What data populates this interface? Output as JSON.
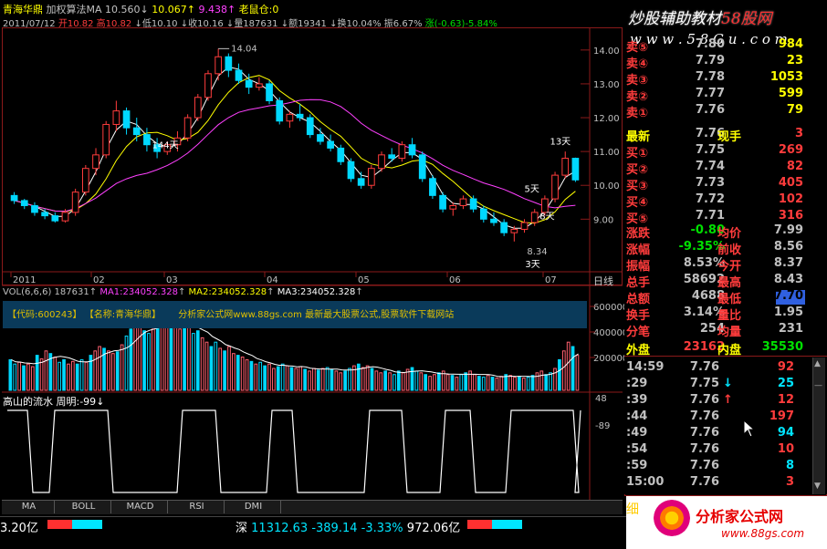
{
  "header": {
    "stock_name": "青海华鼎",
    "method": "加权算法MA",
    "ma_val1": "10.560",
    "ma_arrow1": "↓",
    "ma_val2": "10.067",
    "ma_arrow2": "↑",
    "ma_val3": "9.438",
    "ma_arrow3": "↑",
    "indicator": "老鼠仓:0",
    "date": "2011/07/12",
    "open": "开10.82",
    "high": "高10.82",
    "low_arrow": "↓",
    "low": "低10.10",
    "close_arrow": "↓",
    "close": "收10.16",
    "vol_arrow": "↓",
    "vol": "量187631",
    "amt_arrow": "↓",
    "amt": "额19341",
    "turn_arrow": "↓",
    "turn": "换10.04%",
    "amp": "振6.67%",
    "chg": "涨(-0.63)-5.84%"
  },
  "watermark": {
    "brand": "炒股辅助教材",
    "brand2": "58股网",
    "site": "w w w . 5 8 G u . c o m"
  },
  "chart_data": {
    "type": "candlestick",
    "ylim": [
      8.2,
      14.4
    ],
    "yticks": [
      "14.00",
      "13.00",
      "12.00",
      "11.00",
      "10.00",
      "9.00"
    ],
    "xticks": [
      "2011",
      "02",
      "03",
      "04",
      "05",
      "06",
      "07"
    ],
    "candles": [
      [
        9.7,
        9.8,
        9.45,
        9.55
      ],
      [
        9.55,
        9.6,
        9.3,
        9.4
      ],
      [
        9.4,
        9.5,
        9.1,
        9.2
      ],
      [
        9.2,
        9.3,
        9.0,
        9.1
      ],
      [
        9.1,
        9.2,
        8.9,
        8.95
      ],
      [
        8.95,
        9.3,
        8.9,
        9.2
      ],
      [
        9.2,
        9.9,
        9.1,
        9.8
      ],
      [
        9.8,
        10.6,
        9.7,
        10.5
      ],
      [
        10.5,
        11.1,
        10.3,
        10.9
      ],
      [
        10.9,
        11.9,
        10.8,
        11.8
      ],
      [
        11.8,
        12.5,
        11.6,
        12.2
      ],
      [
        12.2,
        12.3,
        11.5,
        11.7
      ],
      [
        11.7,
        12.0,
        11.3,
        11.5
      ],
      [
        11.5,
        11.7,
        11.0,
        11.2
      ],
      [
        11.2,
        11.4,
        10.8,
        11.0
      ],
      [
        11.0,
        11.3,
        10.9,
        11.2
      ],
      [
        11.2,
        11.6,
        11.0,
        11.4
      ],
      [
        11.4,
        12.1,
        11.3,
        12.0
      ],
      [
        12.0,
        12.7,
        11.9,
        12.6
      ],
      [
        12.6,
        13.4,
        12.5,
        13.3
      ],
      [
        13.3,
        14.04,
        13.1,
        13.8
      ],
      [
        13.8,
        13.9,
        13.2,
        13.4
      ],
      [
        13.4,
        13.6,
        13.0,
        13.1
      ],
      [
        13.1,
        13.3,
        12.7,
        12.9
      ],
      [
        12.9,
        13.2,
        12.8,
        13.0
      ],
      [
        13.0,
        13.1,
        12.4,
        12.5
      ],
      [
        12.5,
        12.6,
        11.8,
        11.9
      ],
      [
        11.9,
        12.2,
        11.7,
        12.1
      ],
      [
        12.1,
        12.4,
        11.9,
        12.0
      ],
      [
        12.0,
        12.1,
        11.4,
        11.5
      ],
      [
        11.5,
        11.7,
        11.2,
        11.3
      ],
      [
        11.3,
        11.5,
        11.0,
        11.1
      ],
      [
        11.1,
        11.2,
        10.6,
        10.7
      ],
      [
        10.7,
        10.8,
        10.1,
        10.2
      ],
      [
        10.2,
        10.4,
        9.9,
        10.0
      ],
      [
        10.0,
        10.6,
        9.9,
        10.5
      ],
      [
        10.5,
        11.0,
        10.4,
        10.9
      ],
      [
        10.9,
        11.1,
        10.7,
        10.8
      ],
      [
        10.8,
        11.3,
        10.7,
        11.2
      ],
      [
        11.2,
        11.4,
        10.8,
        10.9
      ],
      [
        10.9,
        11.0,
        10.1,
        10.2
      ],
      [
        10.2,
        10.3,
        9.6,
        9.7
      ],
      [
        9.7,
        9.8,
        9.2,
        9.3
      ],
      [
        9.3,
        9.5,
        9.1,
        9.4
      ],
      [
        9.4,
        9.7,
        9.3,
        9.6
      ],
      [
        9.6,
        9.7,
        9.2,
        9.3
      ],
      [
        9.3,
        9.4,
        8.9,
        9.0
      ],
      [
        9.0,
        9.2,
        8.8,
        8.9
      ],
      [
        8.9,
        9.0,
        8.5,
        8.6
      ],
      [
        8.6,
        8.8,
        8.34,
        8.7
      ],
      [
        8.7,
        9.0,
        8.6,
        8.9
      ],
      [
        8.9,
        9.3,
        8.8,
        9.2
      ],
      [
        9.2,
        9.7,
        9.1,
        9.6
      ],
      [
        9.6,
        10.4,
        9.5,
        10.3
      ],
      [
        10.3,
        11.0,
        10.2,
        10.8
      ],
      [
        10.8,
        10.82,
        10.1,
        10.16
      ]
    ],
    "labels": {
      "hi": "14.04",
      "lo": "8.34",
      "d13": "13天",
      "d144": "144天",
      "d5": "5天",
      "d8": "8天",
      "d3": "3天"
    }
  },
  "volume": {
    "title": "VOL(6,6,6)",
    "vol": "187631",
    "arrow": "↑",
    "ma1": "MA1:234052.328",
    "ma1_arrow": "↑",
    "ma2": "MA2:234052.328",
    "ma2_arrow": "↑",
    "ma3": "MA3:234052.328",
    "ma3_arrow": "↑",
    "yticks": [
      "600000",
      "400000",
      "200000"
    ],
    "code": "【代码:600243】",
    "name": "【名称:青海华鼎】",
    "banner": "分析家公式网www.88gs.com 最新最大股票公式,股票软件下载网站",
    "bars": [
      0.35,
      0.3,
      0.32,
      0.28,
      0.3,
      0.27,
      0.4,
      0.36,
      0.45,
      0.42,
      0.38,
      0.32,
      0.35,
      0.3,
      0.33,
      0.3,
      0.35,
      0.32,
      0.4,
      0.45,
      0.5,
      0.48,
      0.45,
      0.42,
      0.44,
      0.52,
      0.62,
      0.7,
      0.75,
      0.72,
      0.68,
      0.65,
      0.7,
      0.78,
      0.85,
      0.9,
      0.82,
      0.75,
      0.7,
      0.78,
      0.72,
      0.65,
      0.68,
      0.6,
      0.55,
      0.5,
      0.55,
      0.48,
      0.45,
      0.5,
      0.42,
      0.4,
      0.38,
      0.35,
      0.33,
      0.3,
      0.32,
      0.28,
      0.3,
      0.25,
      0.27,
      0.3,
      0.28,
      0.26,
      0.25,
      0.27,
      0.24,
      0.22,
      0.25,
      0.23,
      0.25,
      0.26,
      0.24,
      0.22,
      0.2,
      0.22,
      0.25,
      0.28,
      0.3,
      0.26,
      0.28,
      0.25,
      0.22,
      0.2,
      0.22,
      0.2,
      0.18,
      0.22,
      0.2,
      0.24,
      0.26,
      0.22,
      0.2,
      0.18,
      0.16,
      0.18,
      0.2,
      0.22,
      0.18,
      0.17,
      0.15,
      0.18,
      0.2,
      0.22,
      0.18,
      0.16,
      0.15,
      0.17,
      0.15,
      0.14,
      0.16,
      0.18,
      0.17,
      0.15,
      0.16,
      0.14,
      0.15,
      0.17,
      0.2,
      0.22,
      0.18,
      0.2,
      0.25,
      0.35,
      0.45,
      0.55,
      0.5,
      0.4
    ]
  },
  "lower": {
    "title": "高山的流水",
    "param": "周明:-99",
    "arrow": "↓",
    "yticks": [
      "48",
      "-89"
    ]
  },
  "tabs": [
    "MA",
    "BOLL",
    "MACD",
    "RSI",
    "DMI"
  ],
  "status": {
    "left_amt": "3.20亿",
    "index_name": "深",
    "index_val": "11312.63",
    "index_chg": "-389.14",
    "index_pct": "-3.33%",
    "index_amt": "972.06亿"
  },
  "quote": {
    "asks": [
      {
        "label": "卖⑤",
        "price": "7.80",
        "vol": "984"
      },
      {
        "label": "卖④",
        "price": "7.79",
        "vol": "23"
      },
      {
        "label": "卖③",
        "price": "7.78",
        "vol": "1053"
      },
      {
        "label": "卖②",
        "price": "7.77",
        "vol": "599"
      },
      {
        "label": "卖①",
        "price": "7.76",
        "vol": "79"
      }
    ],
    "last": {
      "label": "最新",
      "price": "7.76",
      "sub": "现手",
      "vol": "3"
    },
    "bids": [
      {
        "label": "买①",
        "price": "7.75",
        "vol": "269"
      },
      {
        "label": "买②",
        "price": "7.74",
        "vol": "82"
      },
      {
        "label": "买③",
        "price": "7.73",
        "vol": "405"
      },
      {
        "label": "买④",
        "price": "7.72",
        "vol": "102"
      },
      {
        "label": "买⑤",
        "price": "7.71",
        "vol": "316"
      }
    ],
    "stats": [
      {
        "l1": "涨跌",
        "v1": "-0.80",
        "l2": "均价",
        "v2": "7.99"
      },
      {
        "l1": "涨幅",
        "v1": "-9.35%",
        "l2": "前收",
        "v2": "8.56"
      },
      {
        "l1": "振幅",
        "v1": "8.53%",
        "l2": "今开",
        "v2": "8.37"
      },
      {
        "l1": "总手",
        "v1": "58692",
        "l2": "最高",
        "v2": "8.43"
      },
      {
        "l1": "总额",
        "v1": "4688",
        "l2": "最低",
        "v2": "7.70"
      },
      {
        "l1": "换手",
        "v1": "3.14%",
        "l2": "量比",
        "v2": "1.95"
      },
      {
        "l1": "分笔",
        "v1": "254",
        "l2": "均量",
        "v2": "231"
      }
    ],
    "outer": {
      "l1": "外盘",
      "v1": "23162",
      "l2": "内盘",
      "v2": "35530"
    },
    "ticks": [
      {
        "t": "14:59",
        "p": "7.76",
        "a": "",
        "v": "92",
        "c": "red"
      },
      {
        "t": ":29",
        "p": "7.75",
        "a": "↓",
        "v": "25",
        "c": "cyn"
      },
      {
        "t": ":39",
        "p": "7.76",
        "a": "↑",
        "v": "12",
        "c": "red"
      },
      {
        "t": ":44",
        "p": "7.76",
        "a": "",
        "v": "197",
        "c": "red"
      },
      {
        "t": ":49",
        "p": "7.76",
        "a": "",
        "v": "94",
        "c": "cyn"
      },
      {
        "t": ":54",
        "p": "7.76",
        "a": "",
        "v": "10",
        "c": "red"
      },
      {
        "t": ":59",
        "p": "7.76",
        "a": "",
        "v": "8",
        "c": "cyn"
      },
      {
        "t": "15:00",
        "p": "7.76",
        "a": "",
        "v": "3",
        "c": "red"
      }
    ]
  },
  "footer_logo": {
    "name": "分析家公式网",
    "url": "www.88gs.com",
    "left": "细"
  },
  "scroll": {
    "up": "▲",
    "down": "▼",
    "sep": "—"
  }
}
